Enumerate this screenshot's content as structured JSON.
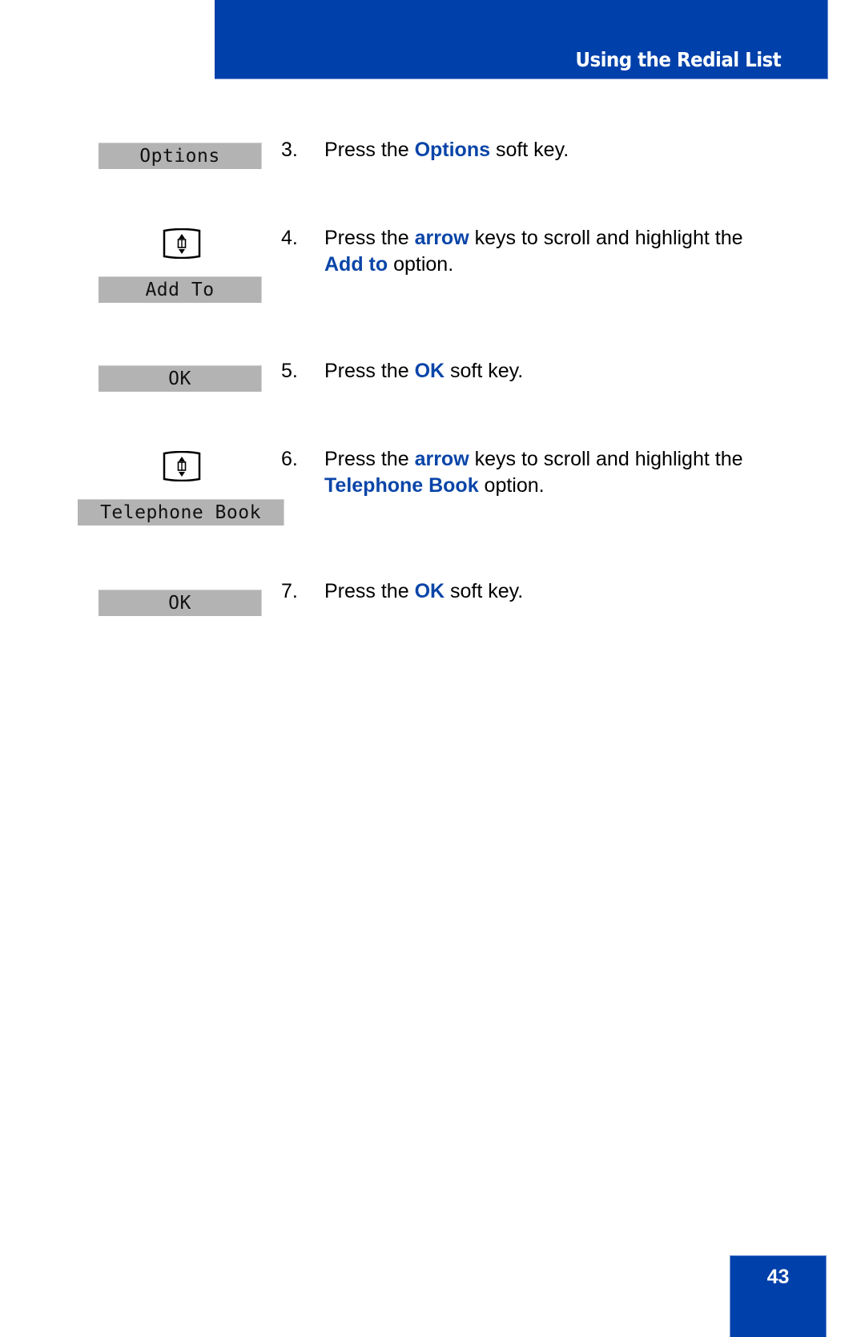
{
  "header": {
    "title": "Using the Redial List",
    "accent_color": "#0040aa"
  },
  "steps": [
    {
      "number": "3.",
      "softkey": "Options",
      "show_nav_icon": false,
      "parts": [
        {
          "text": "Press the ",
          "hl": false
        },
        {
          "text": "Options",
          "hl": true
        },
        {
          "text": " soft key.",
          "hl": false
        }
      ]
    },
    {
      "number": "4.",
      "softkey": "Add To",
      "show_nav_icon": true,
      "parts": [
        {
          "text": "Press the ",
          "hl": false
        },
        {
          "text": "arrow",
          "hl": true
        },
        {
          "text": " keys to scroll and highlight the ",
          "hl": false
        },
        {
          "text": "Add to",
          "hl": true
        },
        {
          "text": " option.",
          "hl": false
        }
      ]
    },
    {
      "number": "5.",
      "softkey": "OK",
      "show_nav_icon": false,
      "parts": [
        {
          "text": "Press the ",
          "hl": false
        },
        {
          "text": "OK",
          "hl": true
        },
        {
          "text": " soft key.",
          "hl": false
        }
      ]
    },
    {
      "number": "6.",
      "softkey": "Telephone Book",
      "show_nav_icon": true,
      "parts": [
        {
          "text": "Press the ",
          "hl": false
        },
        {
          "text": "arrow",
          "hl": true
        },
        {
          "text": " keys to scroll and highlight the ",
          "hl": false
        },
        {
          "text": "Telephone Book",
          "hl": true
        },
        {
          "text": " option.",
          "hl": false
        }
      ]
    },
    {
      "number": "7.",
      "softkey": "OK",
      "show_nav_icon": false,
      "parts": [
        {
          "text": "Press the ",
          "hl": false
        },
        {
          "text": "OK",
          "hl": true
        },
        {
          "text": " soft key.",
          "hl": false
        }
      ]
    }
  ],
  "icons": {
    "nav_key": "navigation-arrow-keys-icon"
  },
  "footer": {
    "page_number": "43"
  },
  "colors": {
    "highlight": "#0a45a8",
    "softkey_bg": "#b3b3b3"
  }
}
